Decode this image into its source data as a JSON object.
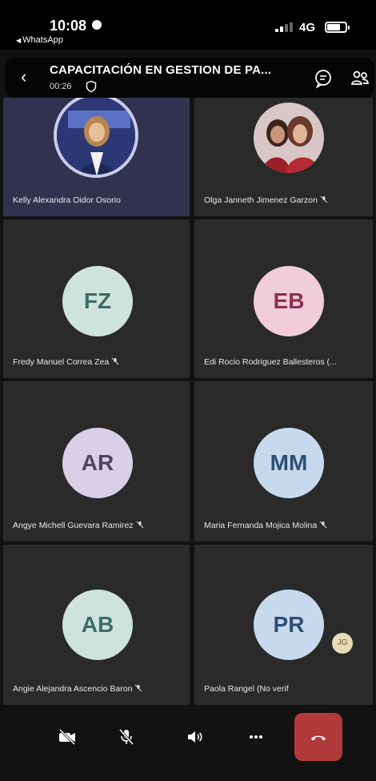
{
  "status_bar": {
    "time": "10:08",
    "back_app": "WhatsApp",
    "network": "4G"
  },
  "call_header": {
    "title": "CAPACITACIÓN EN GESTION DE PA...",
    "timer": "00:26"
  },
  "participants": [
    {
      "name": "Kelly Alexandra Oidor Osorio",
      "type": "photo",
      "muted": false,
      "highlighted": true
    },
    {
      "name": "Olga Janneth Jimenez Garzon",
      "type": "photo",
      "muted": true
    },
    {
      "name": "Fredy Manuel Correa Zea",
      "initials": "FZ",
      "avatar_bg": "#cfe3dd",
      "initials_color": "#3a6e64",
      "muted": true
    },
    {
      "name": "Edi Rocio Rodriguez Ballesteros (...",
      "initials": "EB",
      "avatar_bg": "#f0cdd9",
      "initials_color": "#8b2f52",
      "muted": true
    },
    {
      "name": "Angye Michell Guevara Ramirez",
      "initials": "AR",
      "avatar_bg": "#d8d0e6",
      "initials_color": "#4f4463",
      "muted": true
    },
    {
      "name": "Maria Fernanda Mojica Molina",
      "initials": "MM",
      "avatar_bg": "#c7d9ed",
      "initials_color": "#2d4f75",
      "muted": true
    },
    {
      "name": "Angie Alejandra Ascencio Baron",
      "initials": "AB",
      "avatar_bg": "#cfe3dd",
      "initials_color": "#3a6e64",
      "muted": true
    },
    {
      "name": "Paola Rangel  (No verif",
      "initials": "PR",
      "avatar_bg": "#c7d9ed",
      "initials_color": "#2d4f75",
      "muted": false
    }
  ],
  "overflow_avatar": {
    "initials": "JG"
  },
  "controls": {
    "items": [
      "camera-off",
      "mic-off",
      "speaker",
      "more",
      "end-call"
    ],
    "end_call_color": "#b33a3a"
  }
}
